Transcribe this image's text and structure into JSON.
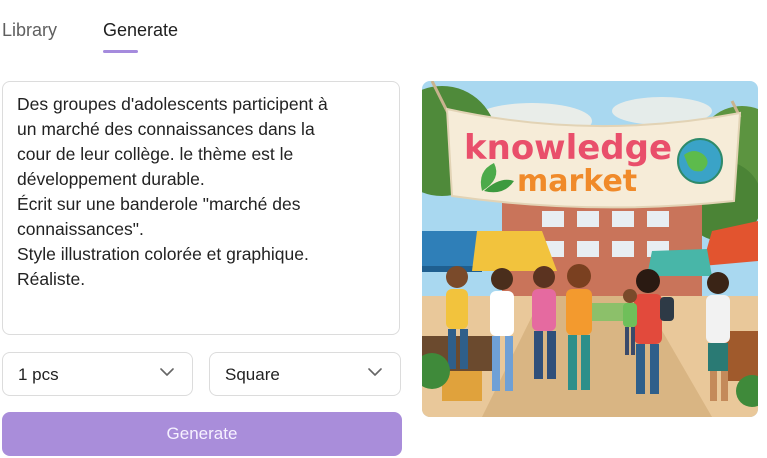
{
  "tabs": {
    "library": "Library",
    "generate": "Generate"
  },
  "prompt": {
    "text": "Des groupes d'adolescents participent à\nun marché des connaissances dans la\ncour de leur collège. le thème est le\ndéveloppement durable.\nÉcrit sur une banderole \"marché des\nconnaissances\".\nStyle illustration colorée et graphique.\nRéaliste."
  },
  "options": {
    "quantity": "1 pcs",
    "aspect": "Square"
  },
  "generate_button": "Generate",
  "image": {
    "banner_line1": "knowledge",
    "banner_line2": "market"
  },
  "colors": {
    "accent": "#a58bdd",
    "button": "#a98dda"
  },
  "icons": {
    "select_arrow": "chevron-down-icon",
    "banner_leaf": "leaf-icon",
    "banner_globe": "globe-icon"
  }
}
